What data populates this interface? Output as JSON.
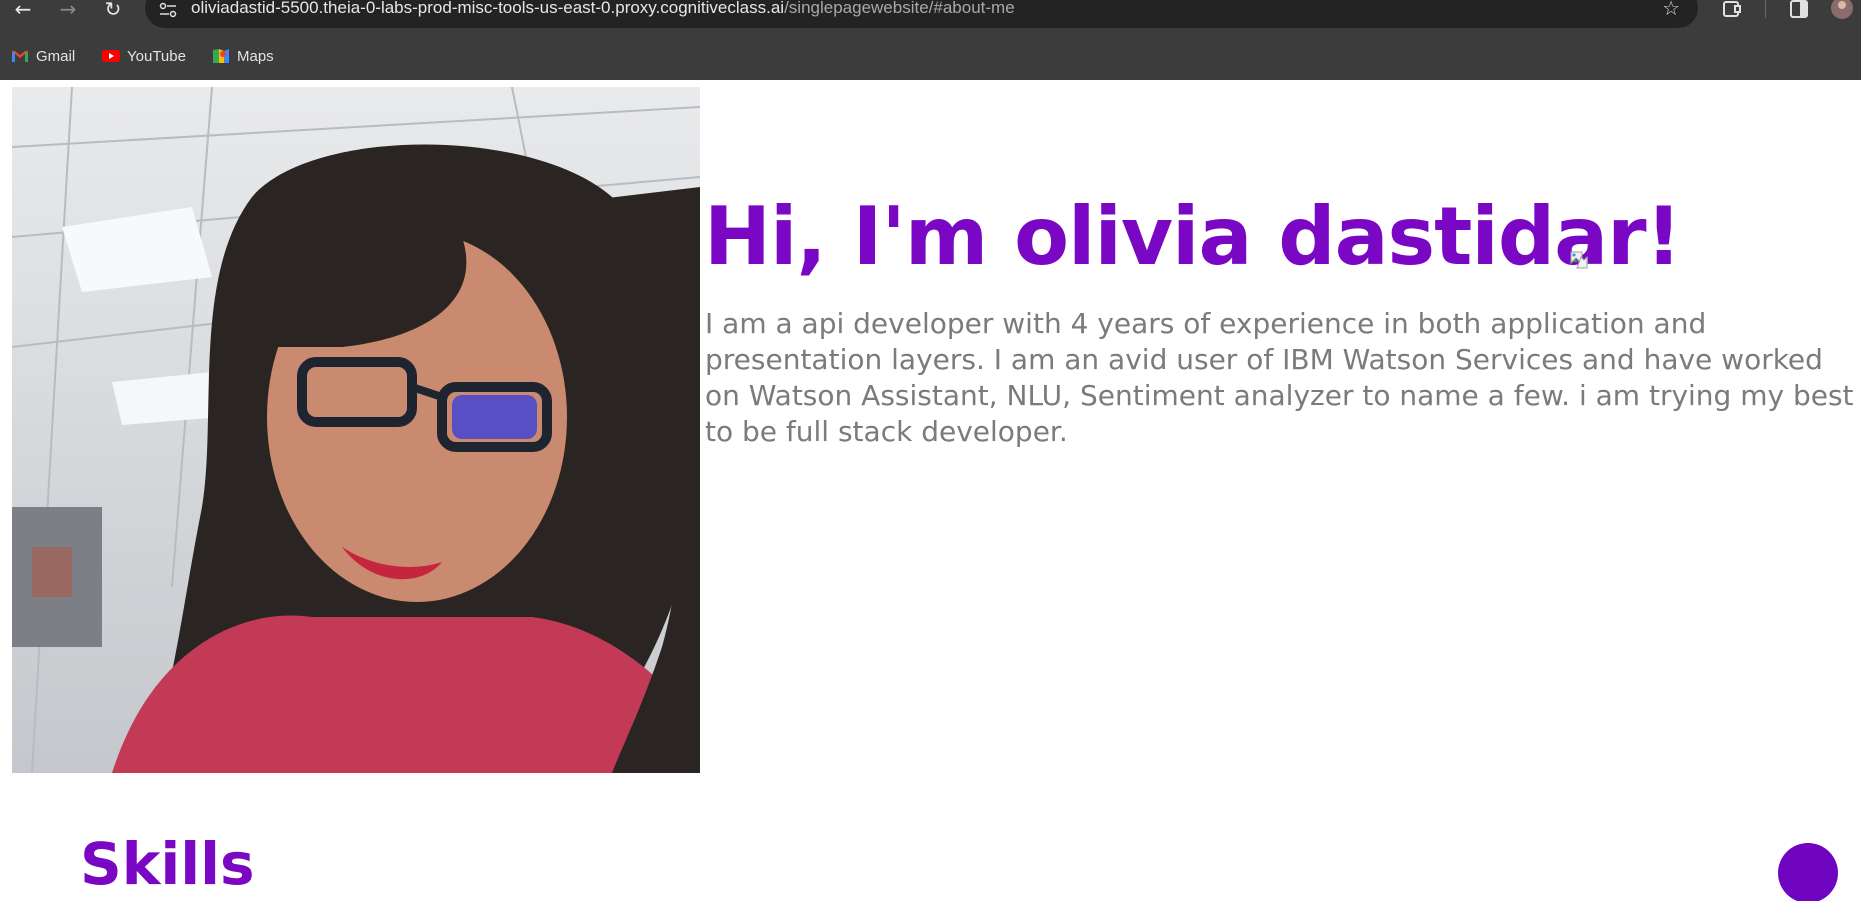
{
  "browser": {
    "url_host": "oliviadastid-5500.theia-0-labs-prod-misc-tools-us-east-0.proxy.cognitiveclass.ai",
    "url_path": "/singlepagewebsite/#about-me",
    "bookmarks": [
      {
        "label": "Gmail",
        "icon": "gmail-icon"
      },
      {
        "label": "YouTube",
        "icon": "youtube-icon"
      },
      {
        "label": "Maps",
        "icon": "maps-icon"
      }
    ]
  },
  "hero": {
    "title": "Hi, I'm olivia dastidar!",
    "about": "I am a api developer with 4 years of experience in both application and presentation layers. I am an avid user of IBM Watson Services and have worked on Watson Assistant, NLU, Sentiment analyzer to name a few. i am trying my best to be full stack developer.",
    "photo_icon": "profile-photo"
  },
  "sections": {
    "skills_title": "Skills"
  },
  "colors": {
    "accent": "#7a07c4",
    "text_gray": "#7b7b7b",
    "chrome_bg": "#3c3c3c"
  }
}
